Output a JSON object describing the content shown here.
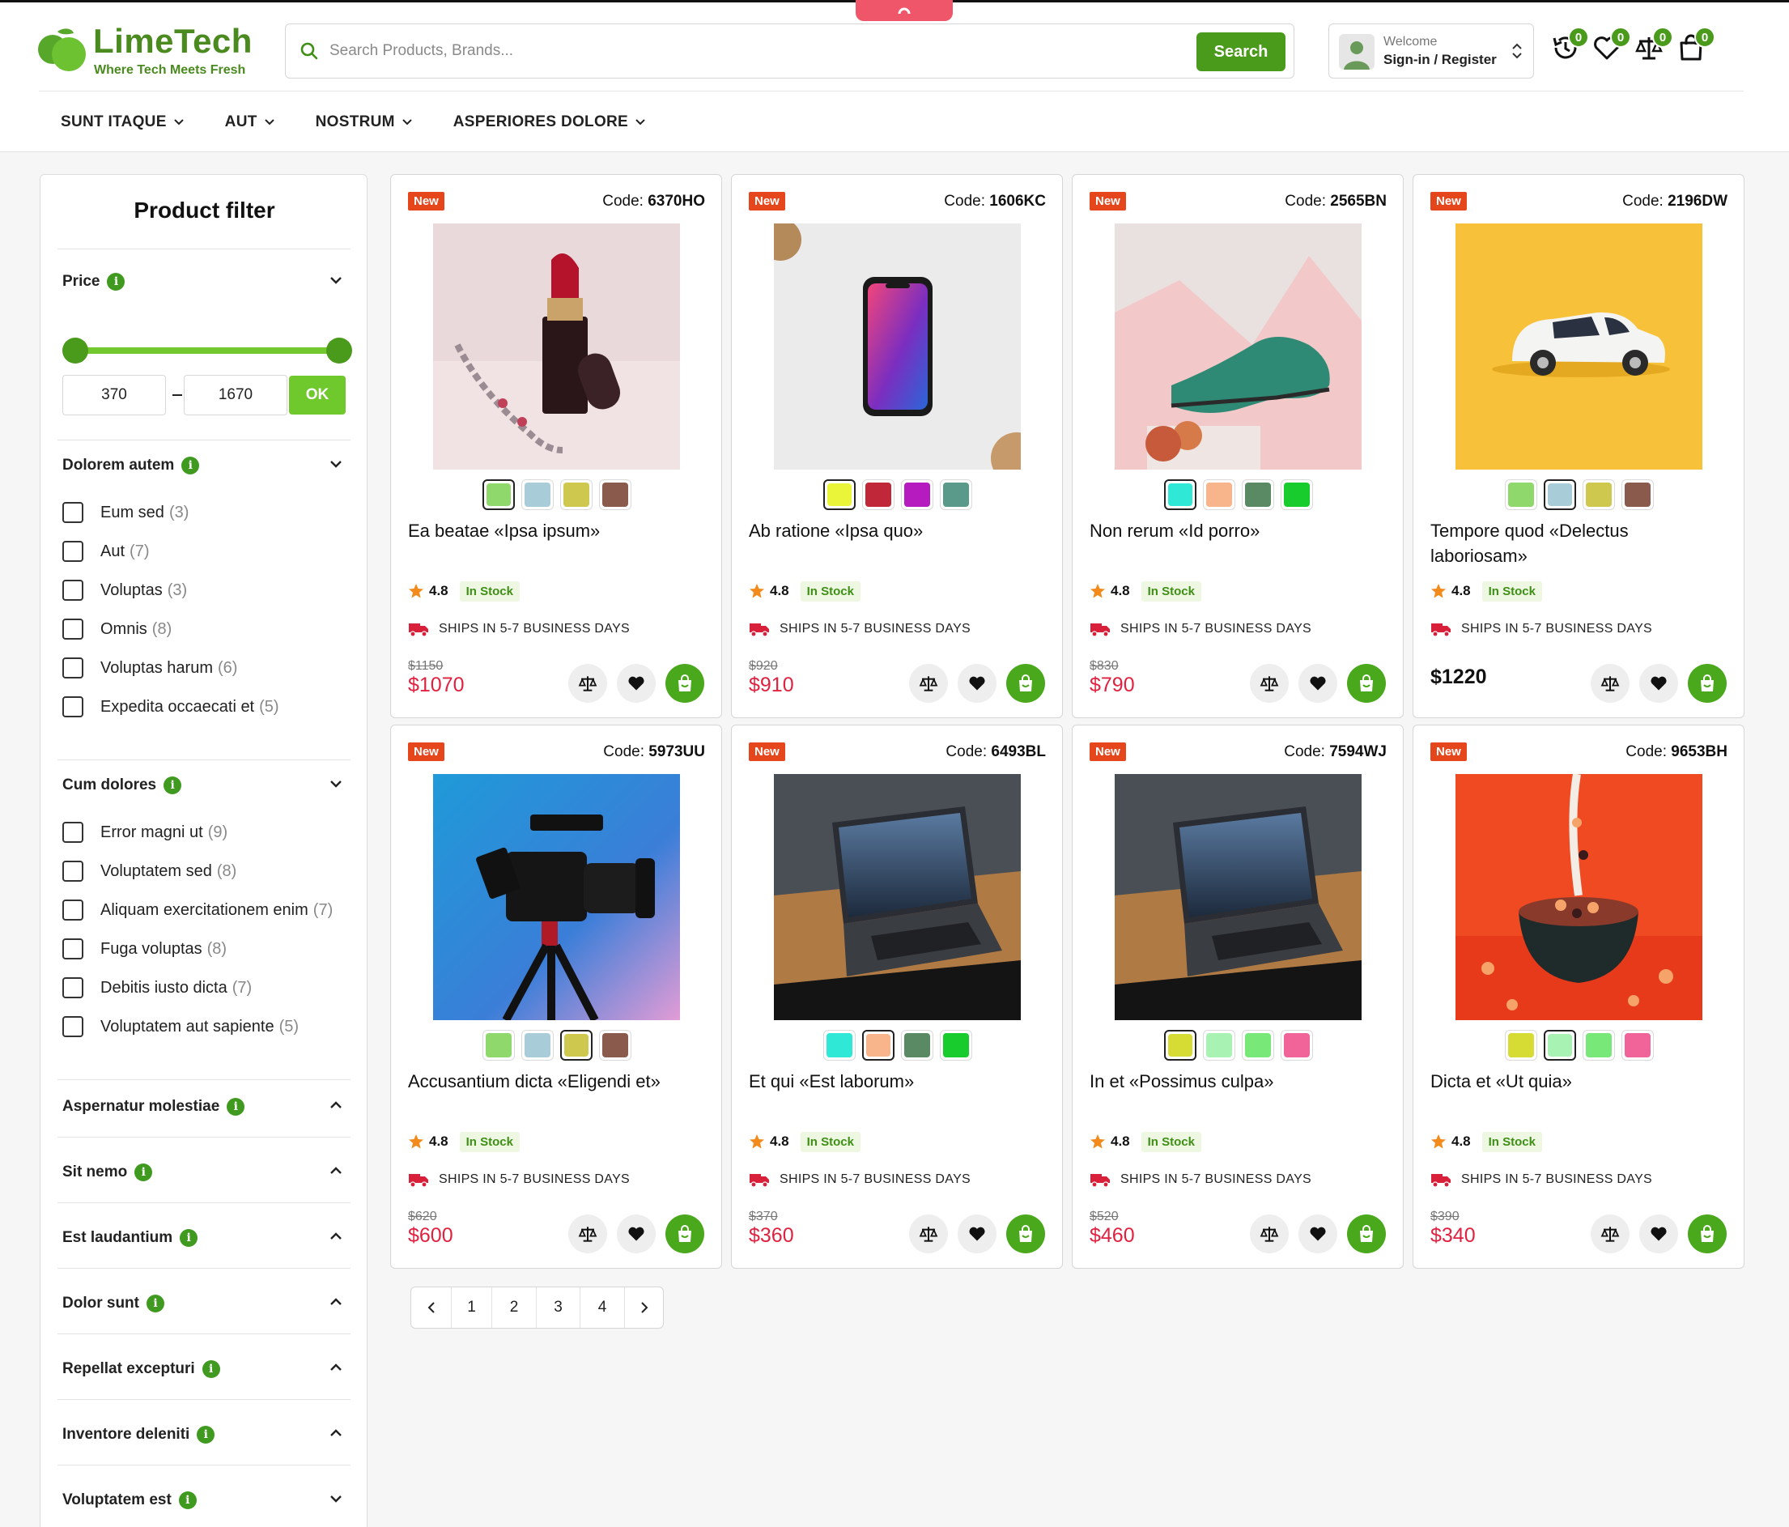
{
  "brand": {
    "name": "LimeTech",
    "tagline": "Where Tech Meets Fresh"
  },
  "search": {
    "placeholder": "Search Products, Brands...",
    "button": "Search"
  },
  "account": {
    "welcome": "Welcome",
    "signin": "Sign-in / Register"
  },
  "header_icons": [
    {
      "icon": "history-icon",
      "count": "0"
    },
    {
      "icon": "heart-icon",
      "count": "0"
    },
    {
      "icon": "compare-icon",
      "count": "0"
    },
    {
      "icon": "shopping-bag-icon",
      "count": "0"
    }
  ],
  "nav": [
    "SUNT ITAQUE",
    "AUT",
    "NOSTRUM",
    "ASPERIORES DOLORE"
  ],
  "filter": {
    "title": "Product filter",
    "price": {
      "label": "Price",
      "min": "370",
      "max": "1670",
      "ok": "OK",
      "range_low": 0.0,
      "range_high": 1.0
    },
    "sections_open": [
      {
        "label": "Dolorem autem",
        "options": [
          {
            "name": "Eum sed",
            "count": "(3)"
          },
          {
            "name": "Aut",
            "count": "(7)"
          },
          {
            "name": "Voluptas",
            "count": "(3)"
          },
          {
            "name": "Omnis",
            "count": "(8)"
          },
          {
            "name": "Voluptas harum",
            "count": "(6)"
          },
          {
            "name": "Expedita occaecati et",
            "count": "(5)"
          }
        ]
      },
      {
        "label": "Cum dolores",
        "options": [
          {
            "name": "Error magni ut",
            "count": "(9)"
          },
          {
            "name": "Voluptatem sed",
            "count": "(8)"
          },
          {
            "name": "Aliquam exercitationem enim",
            "count": "(7)"
          },
          {
            "name": "Fuga voluptas",
            "count": "(8)"
          },
          {
            "name": "Debitis iusto dicta",
            "count": "(7)"
          },
          {
            "name": "Voluptatem aut sapiente",
            "count": "(5)"
          }
        ]
      }
    ],
    "sections_collapsed": [
      {
        "label": "Aspernatur molestiae",
        "chevron": "up"
      },
      {
        "label": "Sit nemo",
        "chevron": "up"
      },
      {
        "label": "Est laudantium",
        "chevron": "up"
      },
      {
        "label": "Dolor sunt",
        "chevron": "up"
      },
      {
        "label": "Repellat excepturi",
        "chevron": "up"
      },
      {
        "label": "Inventore deleniti",
        "chevron": "up"
      },
      {
        "label": "Voluptatem est",
        "chevron": "down"
      }
    ]
  },
  "common": {
    "badge": "New",
    "code_label": "Code:",
    "rating": "4.8",
    "stock": "In Stock",
    "ship": "SHIPS IN 5-7 BUSINESS DAYS"
  },
  "products": [
    {
      "code": "6370HO",
      "title": "Ea beatae «Ipsa ipsum»",
      "old_price": "$1150",
      "price": "$1070",
      "image": "lipstick",
      "swatches": [
        "#8fd86c",
        "#a8ccd8",
        "#cfc84f",
        "#8a5a4c"
      ],
      "selected": 0
    },
    {
      "code": "1606KC",
      "title": "Ab ratione «Ipsa quo»",
      "old_price": "$920",
      "price": "$910",
      "image": "phone",
      "swatches": [
        "#eaf53a",
        "#c0283a",
        "#b61bc0",
        "#5a9a8a"
      ],
      "selected": 0
    },
    {
      "code": "2565BN",
      "title": "Non rerum «Id porro»",
      "old_price": "$830",
      "price": "$790",
      "image": "shoe",
      "swatches": [
        "#2fe8d6",
        "#f8b48a",
        "#5a8a64",
        "#17cc2c"
      ],
      "selected": 0
    },
    {
      "code": "2196DW",
      "title": "Tempore quod «Delectus laboriosam»",
      "old_price": "",
      "price": "$1220",
      "image": "car",
      "swatches": [
        "#8fd86c",
        "#a8ccd8",
        "#cfc84f",
        "#8a5a4c"
      ],
      "selected": 1
    },
    {
      "code": "5973UU",
      "title": "Accusantium dicta «Eligendi et»",
      "old_price": "$620",
      "price": "$600",
      "image": "camera",
      "swatches": [
        "#8fd86c",
        "#a8ccd8",
        "#cfc84f",
        "#8a5a4c"
      ],
      "selected": 2
    },
    {
      "code": "6493BL",
      "title": "Et qui «Est laborum»",
      "old_price": "$370",
      "price": "$360",
      "image": "laptop",
      "swatches": [
        "#2fe8d6",
        "#f8b48a",
        "#5a8a64",
        "#17cc2c"
      ],
      "selected": 1
    },
    {
      "code": "7594WJ",
      "title": "In et «Possimus culpa»",
      "old_price": "$520",
      "price": "$460",
      "image": "laptop",
      "swatches": [
        "#d6dc34",
        "#a8f2b4",
        "#78e878",
        "#f0649a"
      ],
      "selected": 0
    },
    {
      "code": "9653BH",
      "title": "Dicta et «Ut quia»",
      "old_price": "$390",
      "price": "$340",
      "image": "cereal",
      "swatches": [
        "#d6dc34",
        "#a8f2b4",
        "#78e878",
        "#f0649a"
      ],
      "selected": 1
    }
  ],
  "pagination": {
    "pages": [
      "1",
      "2",
      "3",
      "4"
    ],
    "prev": "chevron-left-icon",
    "next": "chevron-right-icon"
  },
  "colors": {
    "accent": "#4a9a1c",
    "badge": "#e5461c",
    "price": "#e0213f"
  }
}
